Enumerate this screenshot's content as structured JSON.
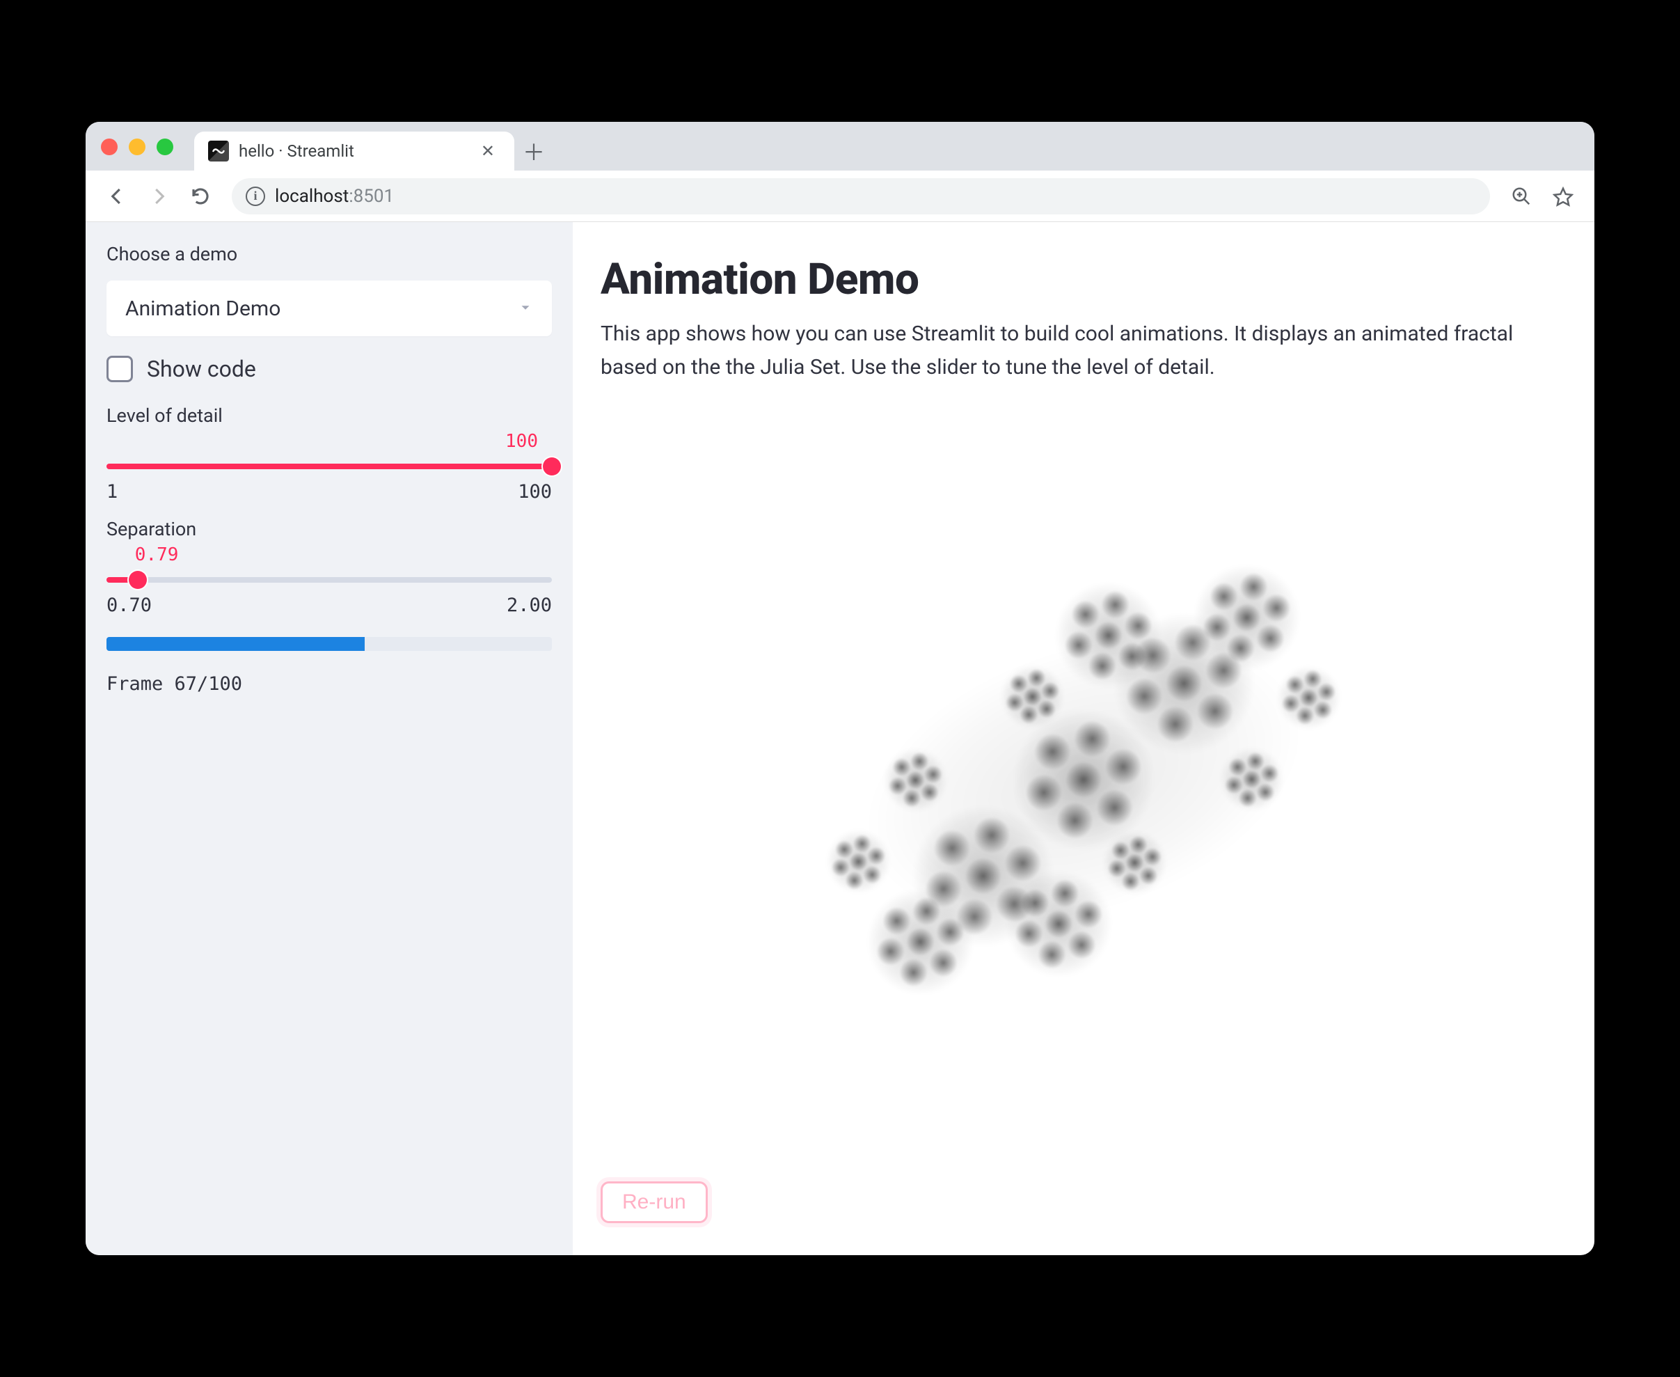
{
  "browser": {
    "tab_title": "hello · Streamlit",
    "url_host": "localhost",
    "url_port": ":8501"
  },
  "sidebar": {
    "choose_label": "Choose a demo",
    "select_value": "Animation Demo",
    "show_code_label": "Show code",
    "show_code_checked": false,
    "slider_detail": {
      "label": "Level of detail",
      "value": "100",
      "min": "1",
      "max": "100",
      "percent": 100
    },
    "slider_separation": {
      "label": "Separation",
      "value": "0.79",
      "min": "0.70",
      "max": "2.00",
      "percent": 7
    },
    "progress_percent": 58,
    "frame_text": "Frame 67/100"
  },
  "main": {
    "title": "Animation Demo",
    "description": "This app shows how you can use Streamlit to build cool animations. It displays an animated fractal based on the the Julia Set. Use the slider to tune the level of detail.",
    "rerun_label": "Re-run"
  },
  "colors": {
    "accent": "#ff2b5b",
    "progress": "#1c83e1"
  }
}
